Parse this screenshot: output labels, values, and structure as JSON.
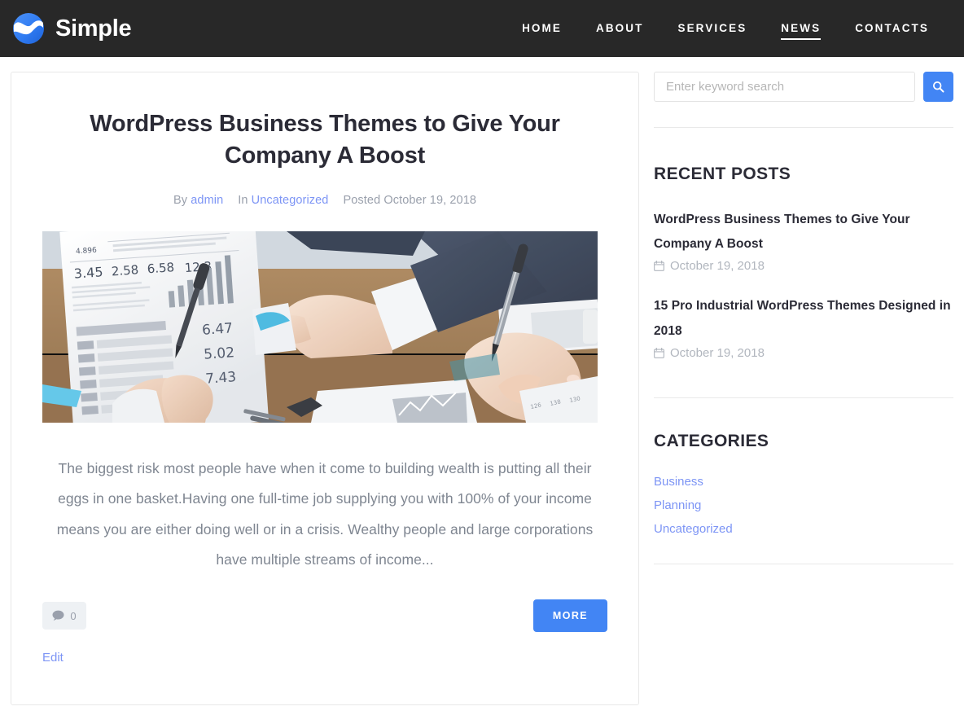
{
  "header": {
    "brand_name": "Simple",
    "logo_icon": "wave-circle-logo-icon",
    "nav": [
      {
        "label": "HOME",
        "active": false
      },
      {
        "label": "ABOUT",
        "active": false
      },
      {
        "label": "SERVICES",
        "active": false
      },
      {
        "label": "NEWS",
        "active": true
      },
      {
        "label": "CONTACTS",
        "active": false
      }
    ]
  },
  "post": {
    "title": "WordPress Business Themes to Give Your Company A Boost",
    "meta": {
      "by_label": "By",
      "author": "admin",
      "in_label": "In",
      "category": "Uncategorized",
      "posted_label": "Posted",
      "date": "October 19, 2018"
    },
    "featured_image_alt": "Business people reviewing financial charts and documents at a desk",
    "excerpt": "The biggest risk most people have when it come to building wealth is putting all their eggs in one basket.Having one full-time job supplying you with 100% of your income means you are either doing well or in a crisis. Wealthy people and large corporations have multiple streams of income...",
    "comment_count": "0",
    "comment_icon": "speech-bubble-icon",
    "more_label": "MORE",
    "edit_label": "Edit"
  },
  "sidebar": {
    "search": {
      "placeholder": "Enter keyword search",
      "value": "",
      "button_icon": "search-icon"
    },
    "recent_posts": {
      "title": "RECENT POSTS",
      "items": [
        {
          "title": "WordPress Business Themes to Give Your Company A Boost",
          "date": "October 19, 2018",
          "date_icon": "calendar-icon"
        },
        {
          "title": "15 Pro Industrial WordPress Themes Designed in 2018",
          "date": "October 19, 2018",
          "date_icon": "calendar-icon"
        }
      ]
    },
    "categories": {
      "title": "CATEGORIES",
      "items": [
        {
          "label": "Business"
        },
        {
          "label": "Planning"
        },
        {
          "label": "Uncategorized"
        }
      ]
    }
  },
  "colors": {
    "header_bg": "#282828",
    "accent": "#4285f4",
    "link": "#7d95f5",
    "heading": "#2b2b36",
    "muted": "#9aa0ac"
  }
}
